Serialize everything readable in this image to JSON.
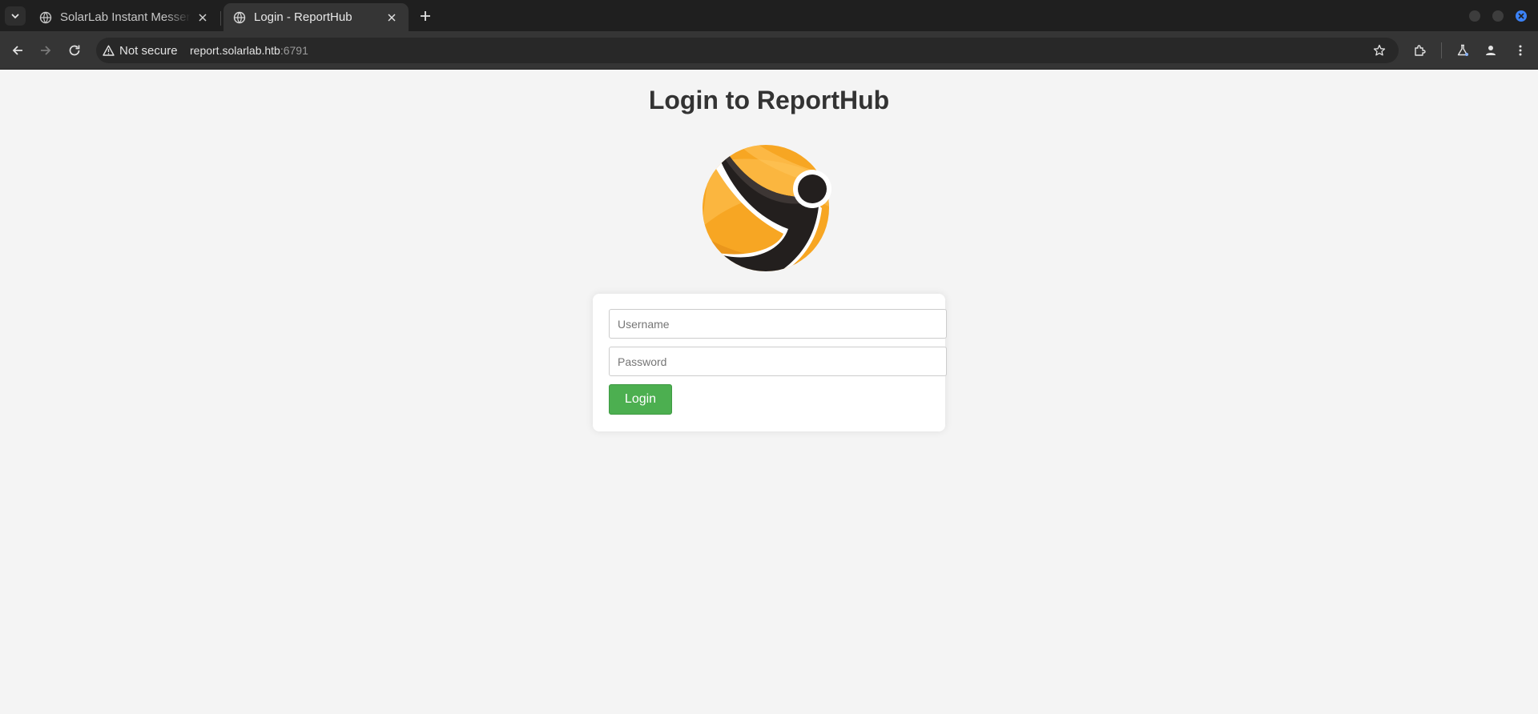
{
  "browser": {
    "tabs": [
      {
        "title": "SolarLab Instant Messenger",
        "active": false
      },
      {
        "title": "Login - ReportHub",
        "active": true
      }
    ],
    "security_label": "Not secure",
    "url_host": "report.solarlab.htb",
    "url_port": ":6791",
    "accent_color": "#3b82f6"
  },
  "page": {
    "title": "Login to ReportHub",
    "logo_colors": {
      "orange": "#f5a623",
      "dark": "#231f1e"
    },
    "username_placeholder": "Username",
    "password_placeholder": "Password",
    "login_label": "Login",
    "button_color": "#4caf50"
  }
}
